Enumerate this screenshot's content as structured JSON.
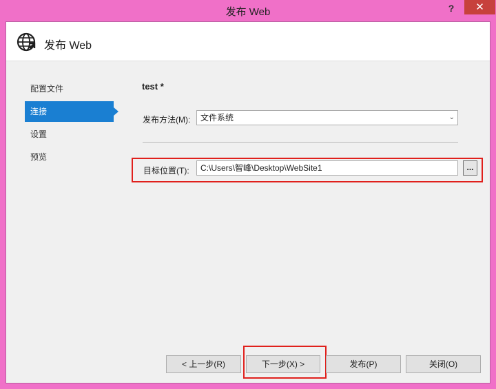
{
  "window": {
    "title": "发布 Web",
    "help_label": "?",
    "close_label": "✕"
  },
  "header": {
    "title": "发布 Web",
    "icon": "globe-publish-icon"
  },
  "nav": {
    "items": [
      {
        "label": "配置文件"
      },
      {
        "label": "连接"
      },
      {
        "label": "设置"
      },
      {
        "label": "预览"
      }
    ],
    "active_index": 1
  },
  "main": {
    "profile_name": "test *",
    "publish_method": {
      "label": "发布方法(M):",
      "value": "文件系统"
    },
    "target_location": {
      "label": "目标位置(T):",
      "value": "C:\\Users\\智峰\\Desktop\\WebSite1",
      "browse_label": "..."
    }
  },
  "buttons": {
    "prev": "< 上一步(R)",
    "next": "下一步(X) >",
    "publish": "发布(P)",
    "close": "关闭(O)"
  },
  "colors": {
    "accent": "#1a7fd2",
    "highlight": "#e0201c",
    "frame": "#f070c8",
    "close_button": "#c7413c"
  }
}
